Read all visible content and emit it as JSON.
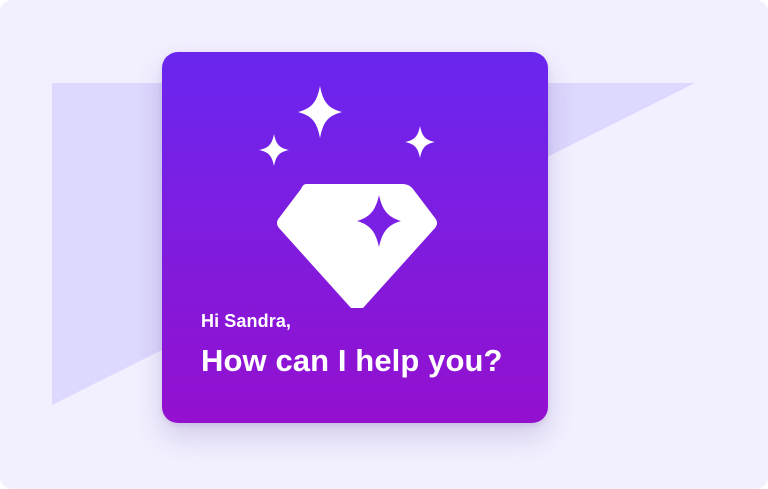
{
  "assistant_card": {
    "greeting": "Hi Sandra,",
    "headline": "How can I help you?",
    "icon": "diamond-sparkle-icon"
  },
  "colors": {
    "page_background": "#f2f0ff",
    "backdrop_shape": "#ddd8fd",
    "card_gradient_top": "#6a26ef",
    "card_gradient_bottom": "#9410cf",
    "icon_fill": "#ffffff",
    "sparkle_inner": "#7a20e5"
  }
}
